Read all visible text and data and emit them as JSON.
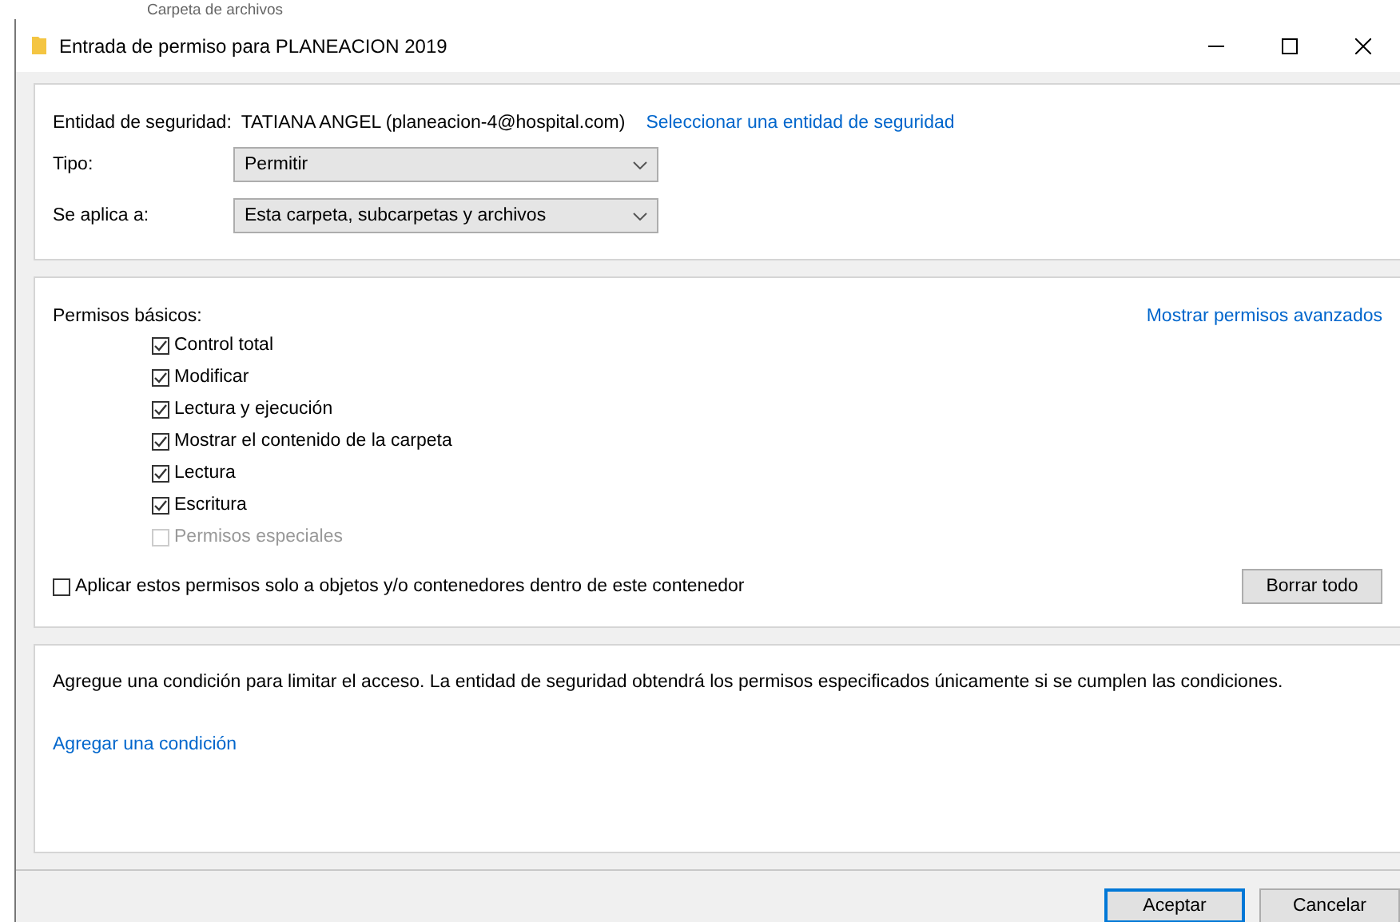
{
  "background_window": {
    "text": "Carpeta de archivos"
  },
  "window": {
    "title": "Entrada de permiso para PLANEACION 2019"
  },
  "principal": {
    "label": "Entidad de seguridad:",
    "value": "TATIANA ANGEL (planeacion-4@hospital.com)",
    "link": "Seleccionar una entidad de seguridad"
  },
  "fields": [
    {
      "label": "Tipo:",
      "value": "Permitir"
    },
    {
      "label": "Se aplica a:",
      "value": "Esta carpeta, subcarpetas y archivos"
    }
  ],
  "permissions": {
    "title": "Permisos básicos:",
    "advanced_link": "Mostrar permisos avanzados",
    "items": [
      {
        "label": "Control total",
        "checked": true,
        "disabled": false
      },
      {
        "label": "Modificar",
        "checked": true,
        "disabled": false
      },
      {
        "label": "Lectura y ejecución",
        "checked": true,
        "disabled": false
      },
      {
        "label": "Mostrar el contenido de la carpeta",
        "checked": true,
        "disabled": false
      },
      {
        "label": "Lectura",
        "checked": true,
        "disabled": false
      },
      {
        "label": "Escritura",
        "checked": true,
        "disabled": false
      },
      {
        "label": "Permisos especiales",
        "checked": false,
        "disabled": true
      }
    ],
    "apply_only": {
      "label": "Aplicar estos permisos solo a objetos y/o contenedores dentro de este contenedor",
      "checked": false
    },
    "clear_button": "Borrar todo"
  },
  "condition": {
    "text": "Agregue una condición para limitar el acceso. La entidad de seguridad obtendrá los permisos especificados únicamente si se cumplen las condiciones.",
    "link": "Agregar una condición"
  },
  "buttons": [
    {
      "label": "Aceptar",
      "default": true
    },
    {
      "label": "Cancelar",
      "default": false
    }
  ]
}
